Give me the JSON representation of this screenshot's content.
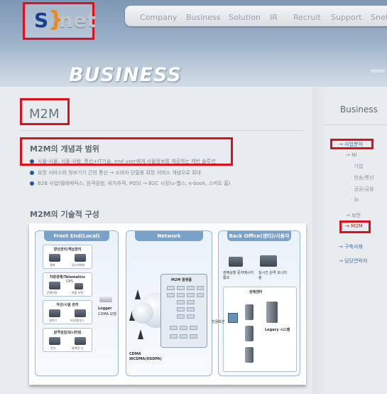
{
  "header": {
    "logo": {
      "s": "S",
      "brace": "}",
      "net": "net"
    },
    "nav": [
      "Company",
      "Business",
      "Solution",
      "IR",
      "Recruit",
      "Support",
      "Snet"
    ],
    "hero_title": "BUSINESS",
    "breadcrumb": "Home >"
  },
  "main": {
    "page_title": "M2M",
    "section1": {
      "title": "M2M의 개념과 범위",
      "bullets": [
        "사물-사물, 사물-사람, 통신+IT기술, end user에게 사물정보를 제공하는 제반 솔루션",
        "유망 서비스와 정보기기 간의 통신 → 소비자 단말용 확장 서비스 개념으로 확대",
        "B2B 사업(텔레매틱스, 원격검침, 위치추적, POS) → B2C 시장(u-헬스, e-book, 스마트 홈)"
      ]
    },
    "section2": {
      "title": "M2M의 기술적 구성"
    }
  },
  "diagram": {
    "panels": [
      "Front End(Local)",
      "Network",
      "Back Office(센터)/사용자"
    ],
    "front": {
      "boxes": [
        "양산관리/계납관리",
        "차량관제/Telematics",
        "자산/시설 관리",
        "원격검침/모니터링"
      ],
      "gps": "GPS",
      "captions": [
        "결제",
        "검시카메라",
        "운행차량",
        "관할 지역",
        "자판기",
        "비상벨/푸스",
        "전기",
        "물계량 기"
      ],
      "logger": [
        "Logger",
        "CDMA 모뎀"
      ]
    },
    "network": {
      "platform_title": "M2M 플랫폼",
      "cdma": [
        "CDMA",
        "WCDMA(HSDPA)"
      ],
      "link_label": "전용회선"
    },
    "back": {
      "users": [
        "관제상황 문자메시지 통보",
        "실시간 원격 모니터링"
      ],
      "center": "관제센터",
      "legacy": "Legacy 시스템"
    }
  },
  "sidebar": {
    "title": "Business",
    "menu": [
      {
        "label": "→ 사업분야",
        "level": 1
      },
      {
        "label": "→ NI",
        "level": 2
      },
      {
        "label": "· 기업",
        "level": 3
      },
      {
        "label": "· 방송/통신",
        "level": 3
      },
      {
        "label": "· 공공/금융",
        "level": 3
      },
      {
        "label": "· SI",
        "level": 3
      },
      {
        "label": "→ 보안",
        "level": 2
      },
      {
        "label": "→ M2M",
        "level": 2
      },
      {
        "label": "→ 구축사례",
        "level": 1
      },
      {
        "label": "→ 담당연락처",
        "level": 1
      }
    ]
  },
  "colors": {
    "highlight": "#e0101a",
    "accent": "#1f5c9e",
    "brand_blue": "#1a3e8a",
    "brand_orange": "#e98a1f"
  }
}
